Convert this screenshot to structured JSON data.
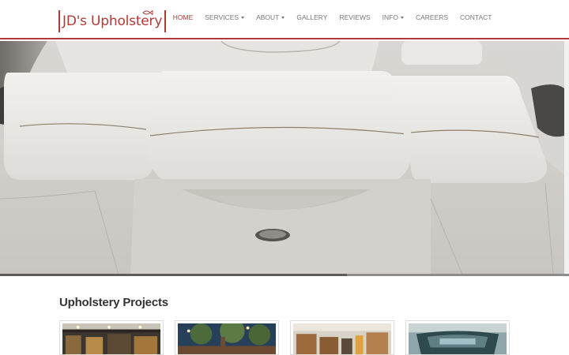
{
  "brand": {
    "name": "JD's Upholstery",
    "accent_color": "#b03a36",
    "icon": "fish-logo-icon"
  },
  "nav": {
    "items": [
      {
        "label": "HOME",
        "active": true,
        "dropdown": false
      },
      {
        "label": "SERVICES",
        "active": false,
        "dropdown": true
      },
      {
        "label": "ABOUT",
        "active": false,
        "dropdown": true
      },
      {
        "label": "GALLERY",
        "active": false,
        "dropdown": false
      },
      {
        "label": "REVIEWS",
        "active": false,
        "dropdown": false
      },
      {
        "label": "INFO",
        "active": false,
        "dropdown": true
      },
      {
        "label": "CAREERS",
        "active": false,
        "dropdown": false
      },
      {
        "label": "CONTACT",
        "active": false,
        "dropdown": false
      }
    ]
  },
  "hero": {
    "image": "boat-seat-upholstery-photo",
    "slide_progress": 0.61
  },
  "projects": {
    "title": "Upholstery Projects",
    "items": [
      {
        "image": "restaurant-interior-photo"
      },
      {
        "image": "tree-dining-room-photo"
      },
      {
        "image": "restaurant-booths-photo"
      },
      {
        "image": "boat-interior-photo"
      }
    ]
  }
}
